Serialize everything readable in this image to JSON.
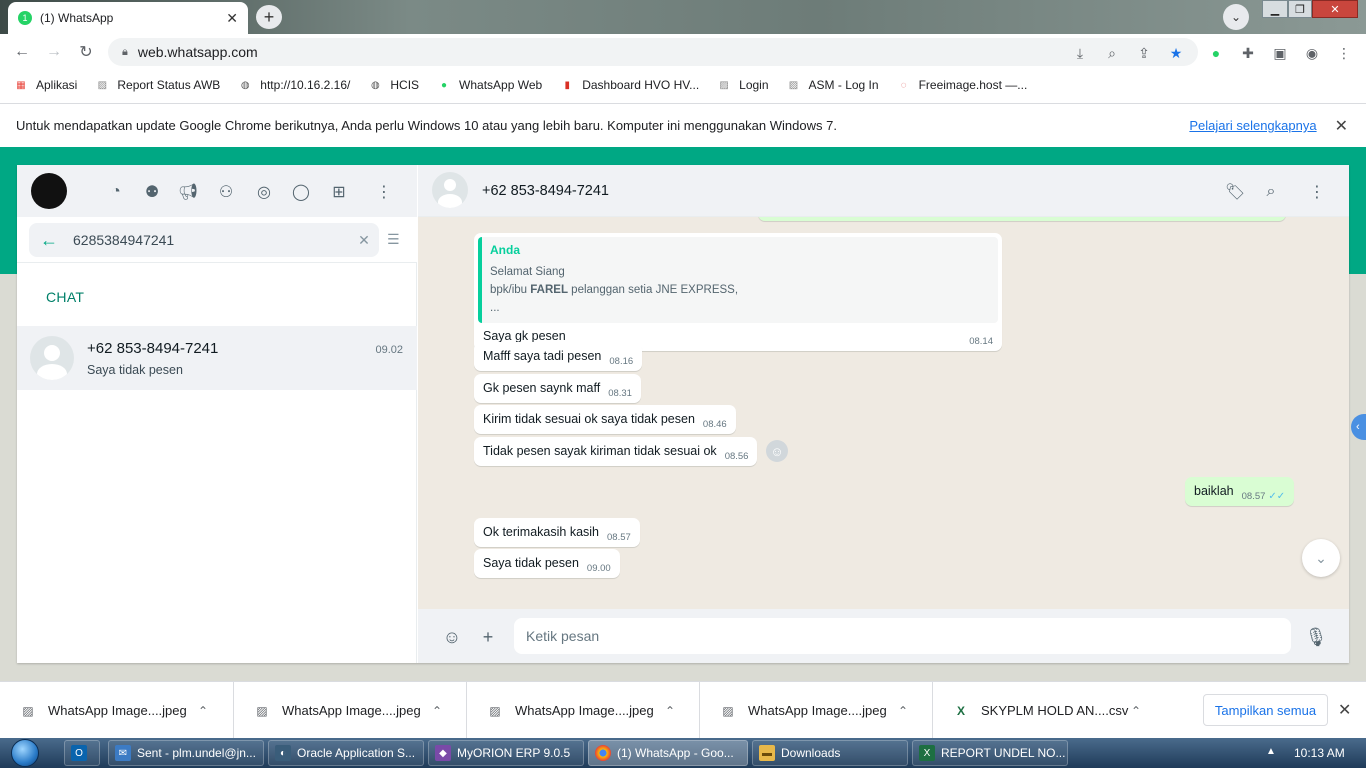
{
  "browser": {
    "tab_title": "(1) WhatsApp",
    "tab_badge": "1",
    "url": "web.whatsapp.com",
    "bookmarks": [
      {
        "label": "Aplikasi",
        "icon": "apps-grid-icon"
      },
      {
        "label": "Report Status AWB",
        "icon": "page-icon"
      },
      {
        "label": "http://10.16.2.16/",
        "icon": "globe-icon"
      },
      {
        "label": "HCIS",
        "icon": "globe-icon"
      },
      {
        "label": "WhatsApp Web",
        "icon": "whatsapp-icon"
      },
      {
        "label": "Dashboard HVO HV...",
        "icon": "dashboard-icon"
      },
      {
        "label": "Login",
        "icon": "page-icon"
      },
      {
        "label": "ASM - Log In",
        "icon": "page-icon"
      },
      {
        "label": "Freeimage.host —...",
        "icon": "freeimage-icon"
      }
    ],
    "infobar": {
      "message": "Untuk mendapatkan update Google Chrome berikutnya, Anda perlu Windows 10 atau yang lebih baru. Komputer ini menggunakan Windows 7.",
      "link": "Pelajari selengkapnya"
    }
  },
  "whatsapp": {
    "colors": {
      "accent": "#00a884",
      "outgoing": "#d9fdd3",
      "background": "#efeae2"
    },
    "search": {
      "value": "6285384947241"
    },
    "section_label": "CHAT",
    "chat_list": [
      {
        "name": "+62 853-8494-7241",
        "time": "09.02",
        "preview": "Saya tidak pesen"
      }
    ],
    "conversation": {
      "contact": "+62 853-8494-7241",
      "quoted": {
        "author": "Anda",
        "line1": "Selamat Siang",
        "line2_pre": " bpk/ibu ",
        "line2_bold": "FAREL",
        "line2_post": " pelanggan setia JNE EXPRESS,",
        "line3": "..."
      },
      "messages": [
        {
          "text": "Saya gk pesen",
          "time": "08.14",
          "dir": "in"
        },
        {
          "text": "Mafff saya tadi pesen",
          "time": "08.16",
          "dir": "in"
        },
        {
          "text": "Gk pesen saynk maff",
          "time": "08.31",
          "dir": "in"
        },
        {
          "text": "Kirim tidak sesuai ok saya tidak pesen",
          "time": "08.46",
          "dir": "in"
        },
        {
          "text": "Tidak pesen sayak kiriman tidak sesuai ok",
          "time": "08.56",
          "dir": "in"
        },
        {
          "text": "baiklah",
          "time": "08.57",
          "dir": "out"
        },
        {
          "text": "Ok terimakasih kasih",
          "time": "08.57",
          "dir": "in"
        },
        {
          "text": "Saya tidak pesen",
          "time": "09.00",
          "dir": "in"
        }
      ],
      "composer_placeholder": "Ketik pesan"
    }
  },
  "downloads": {
    "items": [
      {
        "name": "WhatsApp Image....jpeg",
        "icon": "image-file-icon"
      },
      {
        "name": "WhatsApp Image....jpeg",
        "icon": "image-file-icon"
      },
      {
        "name": "WhatsApp Image....jpeg",
        "icon": "image-file-icon"
      },
      {
        "name": "WhatsApp Image....jpeg",
        "icon": "image-file-icon"
      },
      {
        "name": "SKYPLM HOLD AN....csv",
        "icon": "excel-file-icon"
      }
    ],
    "show_all": "Tampilkan semua"
  },
  "taskbar": {
    "items": [
      {
        "label": "",
        "icon": "outlook-icon"
      },
      {
        "label": "Sent - plm.undel@jn...",
        "icon": "mail-icon"
      },
      {
        "label": "Oracle Application S...",
        "icon": "oracle-icon"
      },
      {
        "label": "MyORION ERP 9.0.5",
        "icon": "orion-icon"
      },
      {
        "label": "(1) WhatsApp - Goo...",
        "icon": "chrome-icon"
      },
      {
        "label": "Downloads",
        "icon": "folder-icon"
      },
      {
        "label": "REPORT UNDEL NO...",
        "icon": "excel-icon"
      }
    ],
    "clock": "10:13 AM"
  }
}
